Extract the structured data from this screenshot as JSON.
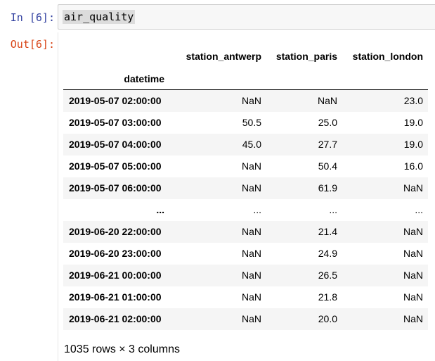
{
  "input_cell": {
    "prompt": "In [6]:",
    "code": "air_quality"
  },
  "output_cell": {
    "prompt": "Out[6]:",
    "table": {
      "columns": [
        "station_antwerp",
        "station_paris",
        "station_london"
      ],
      "index_name": "datetime",
      "rows": [
        {
          "index": "2019-05-07 02:00:00",
          "values": [
            "NaN",
            "NaN",
            "23.0"
          ]
        },
        {
          "index": "2019-05-07 03:00:00",
          "values": [
            "50.5",
            "25.0",
            "19.0"
          ]
        },
        {
          "index": "2019-05-07 04:00:00",
          "values": [
            "45.0",
            "27.7",
            "19.0"
          ]
        },
        {
          "index": "2019-05-07 05:00:00",
          "values": [
            "NaN",
            "50.4",
            "16.0"
          ]
        },
        {
          "index": "2019-05-07 06:00:00",
          "values": [
            "NaN",
            "61.9",
            "NaN"
          ]
        },
        {
          "index": "...",
          "values": [
            "...",
            "...",
            "..."
          ]
        },
        {
          "index": "2019-06-20 22:00:00",
          "values": [
            "NaN",
            "21.4",
            "NaN"
          ]
        },
        {
          "index": "2019-06-20 23:00:00",
          "values": [
            "NaN",
            "24.9",
            "NaN"
          ]
        },
        {
          "index": "2019-06-21 00:00:00",
          "values": [
            "NaN",
            "26.5",
            "NaN"
          ]
        },
        {
          "index": "2019-06-21 01:00:00",
          "values": [
            "NaN",
            "21.8",
            "NaN"
          ]
        },
        {
          "index": "2019-06-21 02:00:00",
          "values": [
            "NaN",
            "20.0",
            "NaN"
          ]
        }
      ]
    },
    "shape_note": "1035 rows × 3 columns"
  }
}
